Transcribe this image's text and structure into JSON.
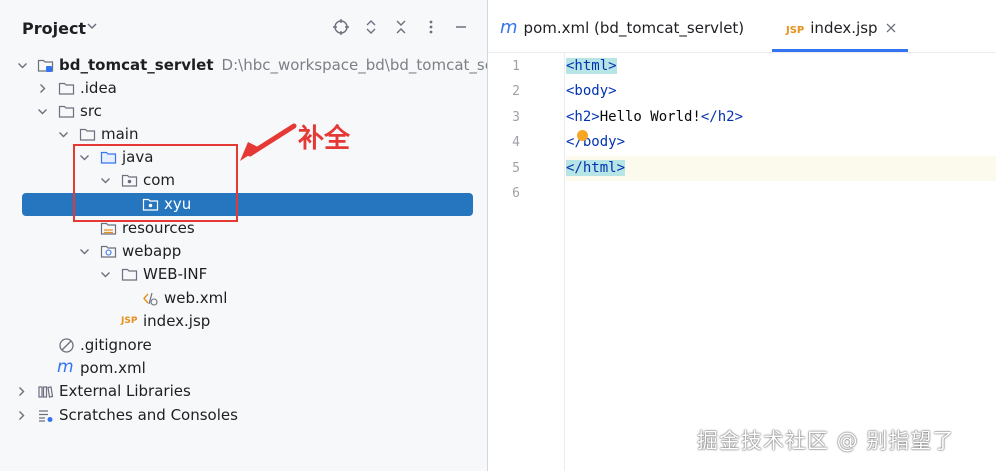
{
  "project_pane": {
    "title": "Project",
    "tree": [
      {
        "id": "root",
        "label": "bd_tomcat_servlet",
        "path": "D:\\hbc_workspace_bd\\bd_tomcat_serv"
      },
      {
        "id": "idea",
        "label": ".idea"
      },
      {
        "id": "src",
        "label": "src"
      },
      {
        "id": "main",
        "label": "main"
      },
      {
        "id": "java",
        "label": "java"
      },
      {
        "id": "com",
        "label": "com"
      },
      {
        "id": "xyu",
        "label": "xyu"
      },
      {
        "id": "resources",
        "label": "resources"
      },
      {
        "id": "webapp",
        "label": "webapp"
      },
      {
        "id": "webinf",
        "label": "WEB-INF"
      },
      {
        "id": "webxml",
        "label": "web.xml"
      },
      {
        "id": "indexjsp",
        "label": "index.jsp"
      },
      {
        "id": "gitignore",
        "label": ".gitignore"
      },
      {
        "id": "pomxml",
        "label": "pom.xml"
      },
      {
        "id": "extlibs",
        "label": "External Libraries"
      },
      {
        "id": "scratches",
        "label": "Scratches and Consoles"
      }
    ]
  },
  "annotation": {
    "text": "补全",
    "color": "#e53935"
  },
  "editor": {
    "tabs": [
      {
        "label": "pom.xml (bd_tomcat_servlet)",
        "active": false
      },
      {
        "label": "index.jsp",
        "active": true
      }
    ],
    "line_numbers": [
      "1",
      "2",
      "3",
      "4",
      "5",
      "6"
    ],
    "code": {
      "l1": {
        "open": "<html>"
      },
      "l2": {
        "open": "<body>"
      },
      "l3": {
        "open": "<h2>",
        "text": "Hello World!",
        "close": "</h2>"
      },
      "l4": {
        "a": "<",
        "b": "/body>"
      },
      "l5": {
        "close": "</html>"
      }
    }
  },
  "icons": {
    "file_type_jsp": "JSP",
    "file_type_maven": "m"
  },
  "watermark": "掘金技术社区 @ 别指望了",
  "colors": {
    "selection": "#2675bf",
    "tag": "#0033b3",
    "accent": "#3574f0",
    "jsp": "#e8901c"
  }
}
